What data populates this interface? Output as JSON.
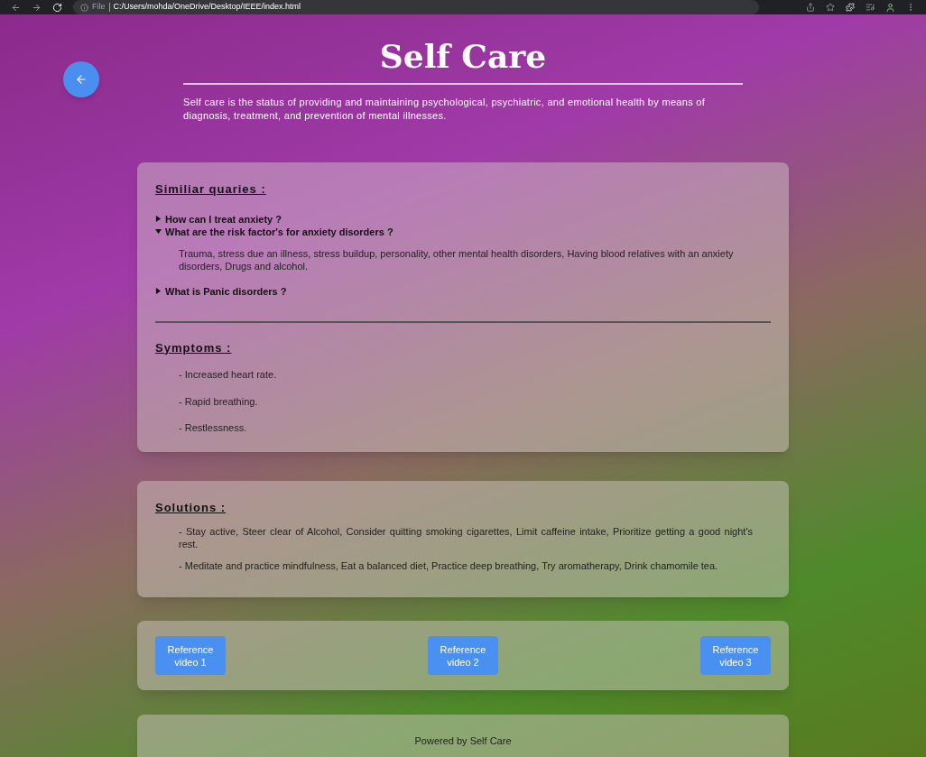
{
  "browser": {
    "file_label": "File",
    "url": "C:/Users/mohda/OneDrive/Desktop/IEEE/index.html"
  },
  "header": {
    "title": "Self Care",
    "intro": "Self care is the status of providing and maintaining psychological, psychiatric, and emotional health by means of diagnosis, treatment, and prevention of mental illnesses."
  },
  "queries": {
    "heading": "Similiar quaries :",
    "items": [
      {
        "question": "How can I treat anxiety ?",
        "expanded": false
      },
      {
        "question": "What are the risk factor's for anxiety disorders ?",
        "expanded": true,
        "answer": "Trauma, stress due an illness, stress buildup, personality, other mental health disorders, Having blood relatives with an anxiety disorders, Drugs and alcohol."
      },
      {
        "question": "What is Panic disorders ?",
        "expanded": false
      }
    ]
  },
  "symptoms": {
    "heading": "Symptoms :",
    "items": [
      "- Increased heart rate.",
      "- Rapid breathing.",
      "- Restlessness."
    ]
  },
  "solutions": {
    "heading": "Solutions :",
    "items": [
      "- Stay active, Steer clear of Alcohol, Consider quitting smoking cigarettes, Limit caffeine intake, Prioritize getting a good night's rest.",
      "- Meditate and practice mindfulness, Eat a balanced diet, Practice deep breathing, Try aromatherapy, Drink chamomile tea."
    ]
  },
  "videos": [
    "Reference video 1",
    "Reference video 2",
    "Reference video 3"
  ],
  "footer": "Powered by Self Care"
}
